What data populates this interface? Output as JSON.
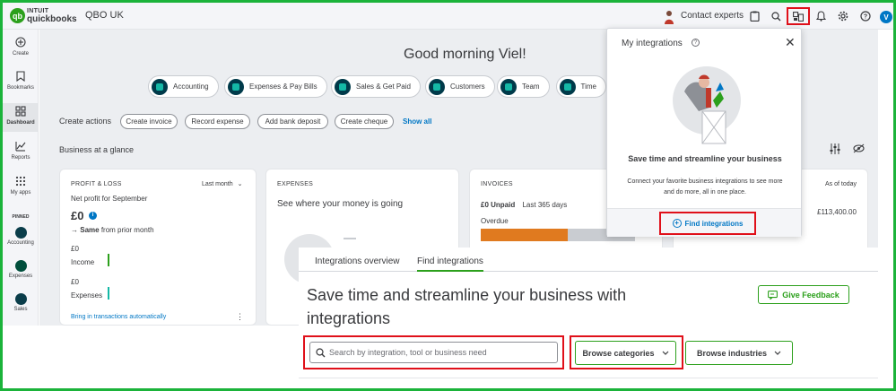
{
  "topbar": {
    "logo_brand": "INTUIT",
    "logo_product": "quickbooks",
    "company": "QBO UK",
    "contact_experts": "Contact experts",
    "user_initial": "V"
  },
  "sidebar": {
    "items": [
      {
        "label": "Create",
        "icon": "plus-circle-icon"
      },
      {
        "label": "Bookmarks",
        "icon": "bookmark-icon"
      },
      {
        "label": "Dashboard",
        "icon": "dashboard-icon"
      },
      {
        "label": "Reports",
        "icon": "reports-icon"
      },
      {
        "label": "My apps",
        "icon": "apps-grid-icon"
      }
    ],
    "pinned_label": "PINNED",
    "pinned": [
      {
        "label": "Accounting"
      },
      {
        "label": "Expenses"
      },
      {
        "label": "Sales"
      }
    ]
  },
  "dashboard": {
    "greeting": "Good morning Viel!",
    "pills": [
      "Accounting",
      "Expenses & Pay Bills",
      "Sales & Get Paid",
      "Customers",
      "Team",
      "Time"
    ],
    "create_actions_label": "Create actions",
    "create_actions": [
      "Create invoice",
      "Record expense",
      "Add bank deposit",
      "Create cheque"
    ],
    "show_all": "Show all",
    "glance_label": "Business at a glance",
    "pl": {
      "title": "PROFIT & LOSS",
      "period": "Last month",
      "subtitle": "Net profit for September",
      "amount": "£0",
      "trend": "Same",
      "trend_suffix": "from prior month",
      "income_amount": "£0",
      "income_label": "Income",
      "expenses_amount": "£0",
      "expenses_label": "Expenses",
      "footer": "Bring in transactions automatically"
    },
    "expenses": {
      "title": "EXPENSES",
      "headline": "See where your money is going"
    },
    "invoices": {
      "title": "INVOICES",
      "unpaid": "£0 Unpaid",
      "period": "Last 365 days",
      "overdue": "Overdue"
    },
    "bank": {
      "as_of": "As of today",
      "amount": "£113,400.00"
    }
  },
  "popover": {
    "title": "My integrations",
    "headline": "Save time and streamline your business",
    "body": "Connect your favorite business integrations to see more and do more, all in one place.",
    "find_button": "Find integrations"
  },
  "integrations": {
    "tabs": [
      "Integrations overview",
      "Find integrations"
    ],
    "title": "Save time and streamline your business with integrations",
    "feedback_button": "Give Feedback",
    "search_placeholder": "Search by integration, tool or business need",
    "browse_categories": "Browse categories",
    "browse_industries": "Browse industries"
  },
  "colors": {
    "accent_green": "#2ca01c",
    "highlight_red": "#e0101a",
    "frame_green": "#1bb33a",
    "link_blue": "#0077c5"
  }
}
